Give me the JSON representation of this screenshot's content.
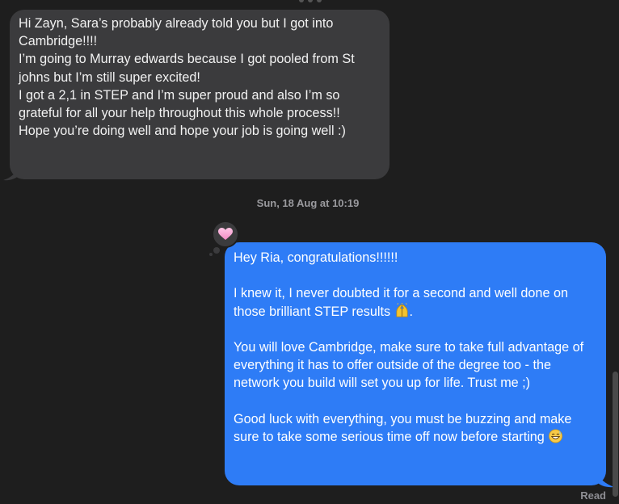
{
  "conversation": {
    "incoming": {
      "lines": [
        "Hi Zayn, Sara’s probably already told you but I got into Cambridge!!!!",
        "I’m going to Murray edwards because I got pooled from St johns but I’m still super excited!",
        "I got a 2,1 in STEP and I’m super proud and also I’m so grateful for all your help throughout this whole process!!",
        "Hope you’re doing well and hope your job is going well :)"
      ]
    },
    "timestamp": "Sun, 18 Aug at 10:19",
    "tapback": {
      "icon": "heart-icon",
      "color": "#f7a6d4"
    },
    "outgoing": {
      "greeting": "Hey Ria, congratulations!!!!!!",
      "para1_text": "I knew it, I never doubted it for a second and well done on those brilliant STEP results",
      "para1_emoji": "raised-hands-icon",
      "para1_end": ".",
      "para2": "You will love Cambridge, make sure to take full advantage of everything it has to offer outside of the degree too - the network you build will set you up for life. Trust me ;)",
      "para3_text": "Good luck with everything, you must be buzzing and make sure to take some serious time off now before starting",
      "para3_emoji": "grinning-sweat-icon"
    },
    "read_receipt": "Read"
  },
  "colors": {
    "background": "#1e1e1e",
    "incoming_bubble": "#3b3b3d",
    "outgoing_bubble": "#2e7cf6"
  }
}
